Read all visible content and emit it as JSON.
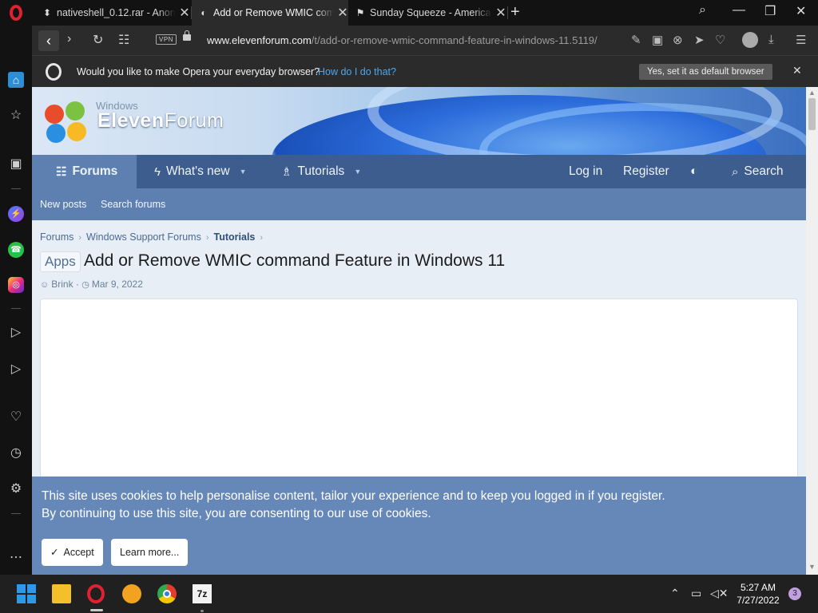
{
  "browser": {
    "tabs": [
      {
        "label": "nativeshell_0.12.rar - Anon",
        "icon": "file-icon",
        "active": false
      },
      {
        "label": "Add or Remove WMIC com",
        "icon": "elevenforum-favicon",
        "active": true
      },
      {
        "label": "Sunday Squeeze - America",
        "icon": "flag-favicon",
        "active": false
      }
    ],
    "vpn_label": "VPN",
    "url_host": "www.elevenforum.com",
    "url_path": "/t/add-or-remove-wmic-command-feature-in-windows-11.5119/"
  },
  "infobar": {
    "question": "Would you like to make Opera your everyday browser?",
    "how_link": "How do I do that?",
    "set_default_button": "Yes, set it as default browser"
  },
  "site": {
    "brand_small": "Windows",
    "brand_bold": "Eleven",
    "brand_light": "Forum",
    "nav": {
      "forums": "Forums",
      "whats_new": "What's new",
      "tutorials": "Tutorials",
      "login": "Log in",
      "register": "Register",
      "search": "Search"
    },
    "subnav": {
      "new_posts": "New posts",
      "search_forums": "Search forums"
    },
    "breadcrumbs": [
      "Forums",
      "Windows Support Forums",
      "Tutorials"
    ],
    "prefix": "Apps",
    "title": "Add or Remove WMIC command Feature in Windows 11",
    "author": "Brink",
    "date": "Mar 9, 2022",
    "cookie": {
      "line1": "This site uses cookies to help personalise content, tailor your experience and to keep you logged in if you register.",
      "line2": "By continuing to use this site, you are consenting to our use of cookies.",
      "accept": "Accept",
      "learn_more": "Learn more..."
    }
  },
  "taskbar": {
    "apps": [
      "start",
      "file-explorer",
      "opera",
      "brave",
      "chrome",
      "7-zip"
    ],
    "seven_zip_label": "7z",
    "time": "5:27 AM",
    "date": "7/27/2022",
    "notification_count": "3"
  },
  "colors": {
    "nav_bar": "#3c5d8d",
    "nav_active": "#5e80b0",
    "cookie_bar": "#6688b9",
    "opera_red": "#e0212f",
    "link_blue": "#4ea6ec"
  }
}
